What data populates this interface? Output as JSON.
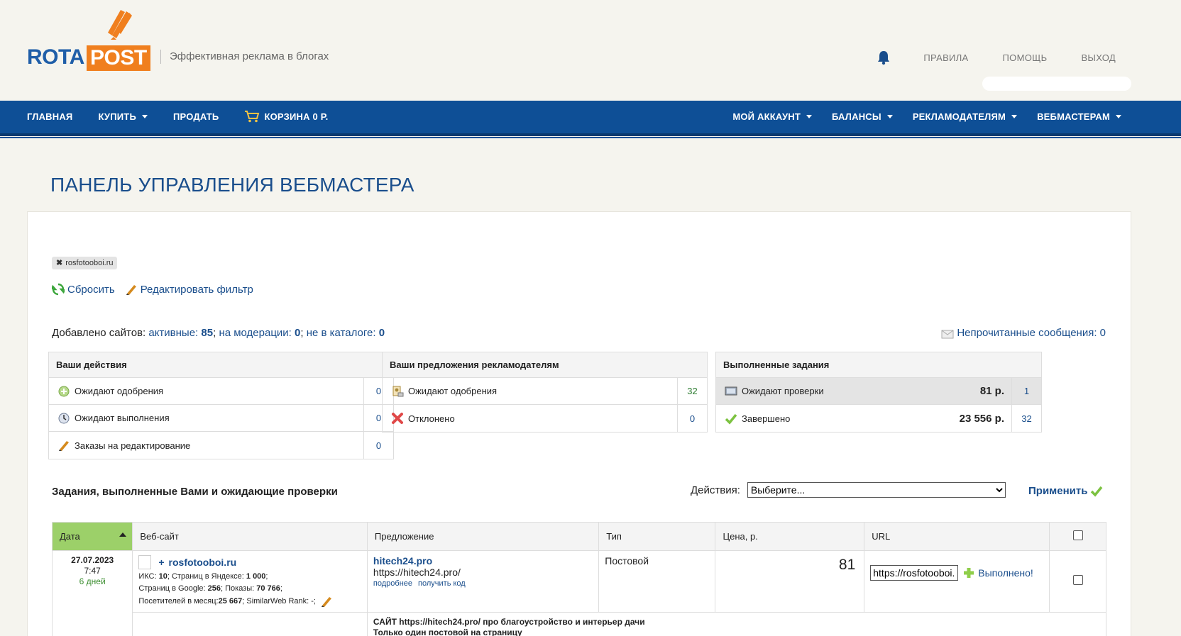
{
  "header": {
    "logo_left": "ROTA",
    "logo_right": "POST",
    "tagline": "Эффективная реклама в блогах",
    "links": [
      "ПРАВИЛА",
      "ПОМОЩЬ",
      "ВЫХОД"
    ]
  },
  "nav": {
    "left": [
      {
        "label": "ГЛАВНАЯ",
        "dropdown": false
      },
      {
        "label": "КУПИТЬ",
        "dropdown": true
      },
      {
        "label": "ПРОДАТЬ",
        "dropdown": false
      }
    ],
    "cart_label": "КОРЗИНА 0 Р.",
    "right": [
      {
        "label": "МОЙ АККАУНТ"
      },
      {
        "label": "БАЛАНСЫ"
      },
      {
        "label": "РЕКЛАМОДАТЕЛЯМ"
      },
      {
        "label": "ВЕБМАСТЕРАМ"
      }
    ]
  },
  "page_title": "ПАНЕЛЬ УПРАВЛЕНИЯ ВЕБМАСТЕРА",
  "filter": {
    "tag": "rosfotooboi.ru",
    "reset": "Сбросить",
    "edit": "Редактировать фильтр"
  },
  "sites": {
    "prefix": "Добавлено сайтов:",
    "active_label": "активные:",
    "active_count": "85",
    "moderation_label": "на модерации:",
    "moderation_count": "0",
    "notcatalog_label": "не в каталоге:",
    "notcatalog_count": "0",
    "sep": ";"
  },
  "unread": "Непрочитанные сообщения: 0",
  "boxes": {
    "actions": {
      "title": "Ваши действия",
      "rows": [
        {
          "label": "Ожидают одобрения",
          "count": "0"
        },
        {
          "label": "Ожидают выполнения",
          "count": "0"
        },
        {
          "label": "Заказы на редактирование",
          "count": "0"
        }
      ]
    },
    "offers": {
      "title": "Ваши предложения рекламодателям",
      "rows": [
        {
          "label": "Ожидают одобрения",
          "count": "32"
        },
        {
          "label": "Отклонено",
          "count": "0"
        }
      ]
    },
    "done": {
      "title": "Выполненные задания",
      "rows": [
        {
          "label": "Ожидают проверки",
          "amount": "81 р.",
          "count": "1"
        },
        {
          "label": "Завершено",
          "amount": "23 556 р.",
          "count": "32"
        }
      ]
    }
  },
  "tasks": {
    "title": "Задания, выполненные Вами и ожидающие проверки",
    "actions_label": "Действия:",
    "select_value": "Выберите...",
    "apply": "Применить",
    "columns": [
      "Дата",
      "Веб-сайт",
      "Предложение",
      "Тип",
      "Цена, р.",
      "URL"
    ],
    "row": {
      "date": "27.07.2023",
      "time": "7:47",
      "days": "6 дней",
      "site": "rosfotooboi.ru",
      "metrics1": "ИКС: ",
      "iks": "10",
      "metrics2": "; Страниц в Яндексе: ",
      "yandex": "1 000",
      "metrics3": "Страниц в Google: ",
      "google": "256",
      "metrics4": "; Показы: ",
      "shows": "70 766",
      "metrics5": "Посетителей в месяц: ",
      "visitors": "25 667",
      "metrics6": "; SimilarWeb Rank: -;",
      "offer_link": "hitech24.pro",
      "offer_url": "https://hitech24.pro/",
      "more": "подробнее",
      "get_code": "получить код",
      "type": "Постовой",
      "price": "81",
      "url_value": "https://rosfotooboi.ru",
      "done": "Выполнено!",
      "desc1": "САЙТ https://hitech24.pro/ про благоустройство и интерьер дачи",
      "desc2": "Только один постовой на страницу"
    }
  }
}
